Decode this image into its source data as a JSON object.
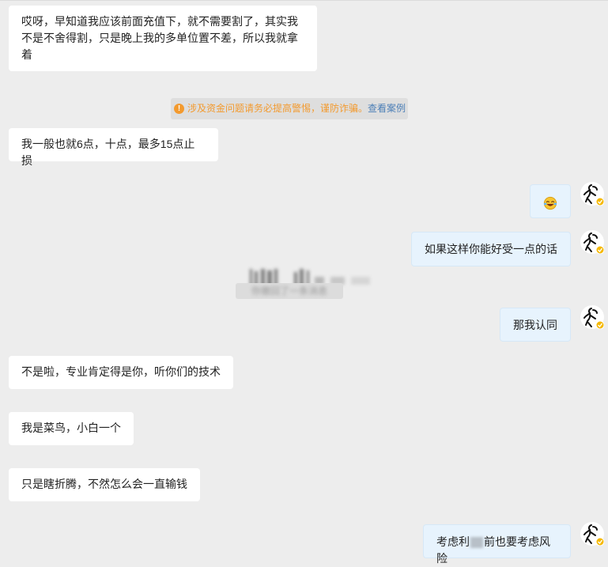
{
  "messages": {
    "m1": "哎呀，早知道我应该前面充值下，就不需要割了，其实我不是不舍得割，只是晚上我的多单位置不差，所以我就拿着",
    "notice": {
      "text": "涉及资金问题请务必提高警惕，谨防诈骗。",
      "link": "查看案例"
    },
    "m2": "我一般也就6点，十点，最多15点止损",
    "m3_emoji": "emoji-laughing-crying",
    "m4": "如果这样你能好受一点的话",
    "system_tip": "你撤回了一条消息",
    "m5": "那我认同",
    "m6": "不是啦，专业肯定得是你，听你们的技术",
    "m7": "我是菜鸟，小白一个",
    "m8": "只是瞎折腾，不然怎么会一直输钱",
    "m9_start": "考虑利",
    "m9_end": "前也要考虑风险"
  },
  "colors": {
    "background": "#ededed",
    "left_bubble": "#ffffff",
    "right_bubble": "#e7f3fd",
    "notice_text": "#f39a2e",
    "notice_link": "#4c7fb7",
    "verified_badge": "#f5b800"
  }
}
